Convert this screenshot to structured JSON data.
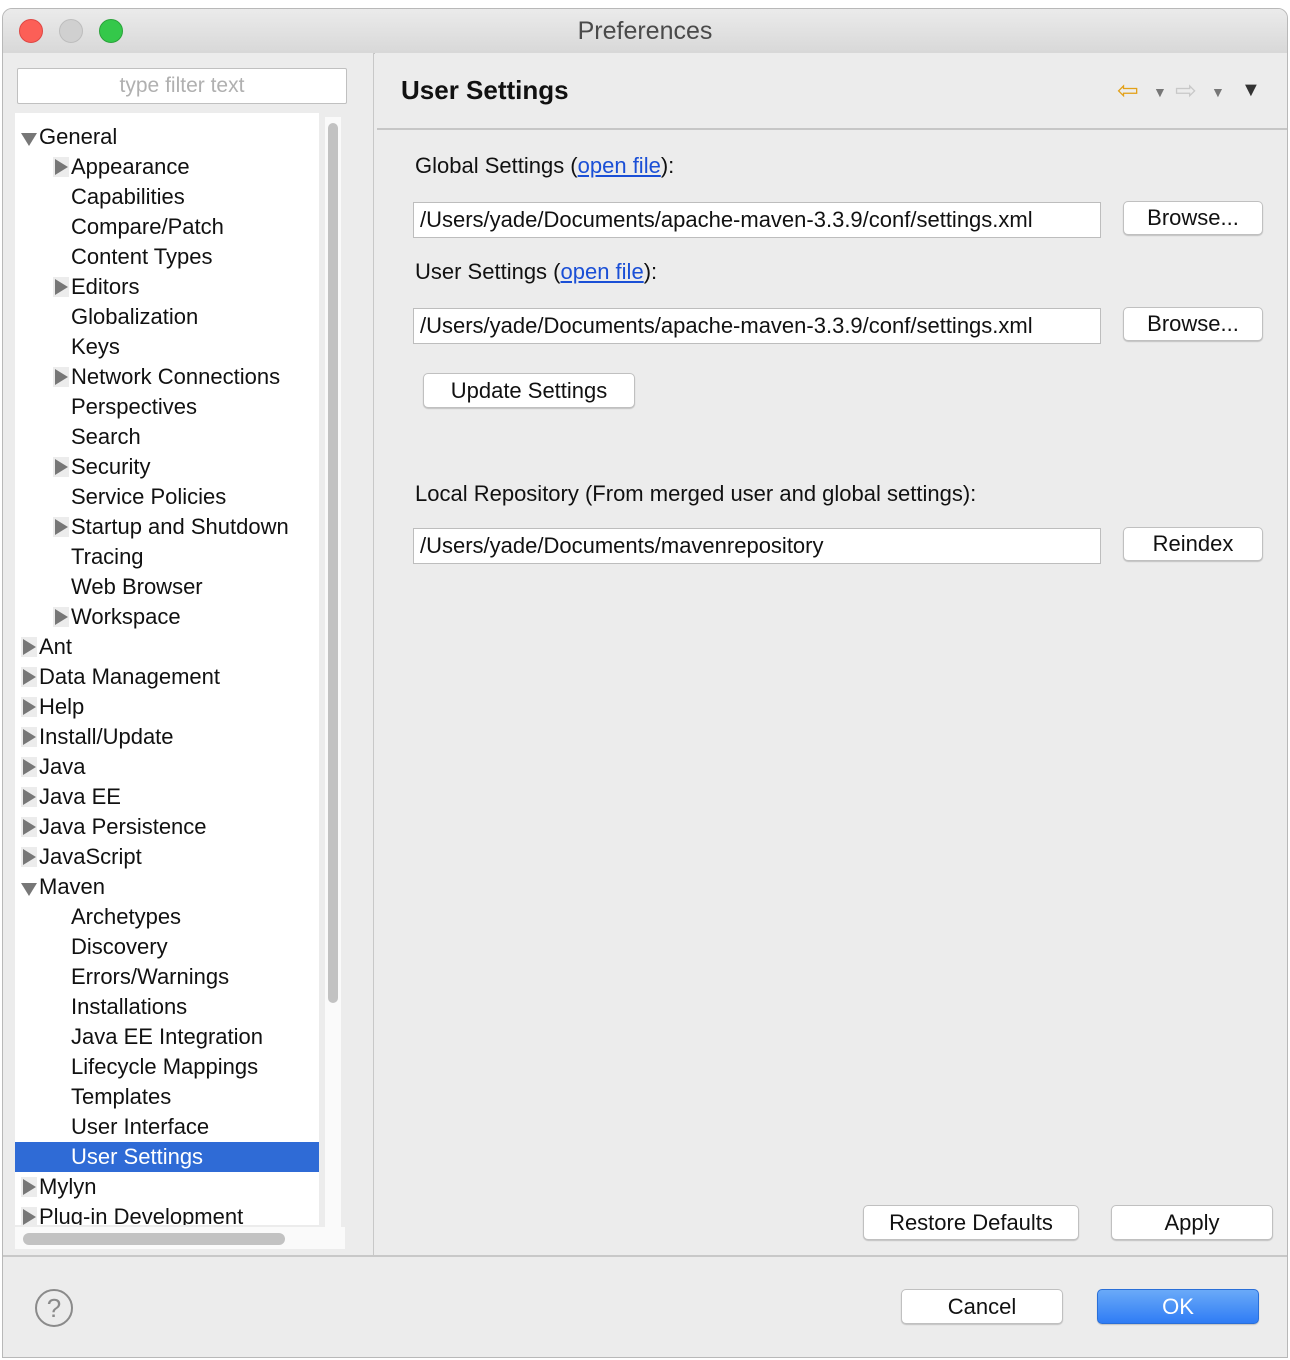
{
  "window": {
    "title": "Preferences"
  },
  "filter": {
    "placeholder": "type filter text"
  },
  "tree": [
    {
      "label": "General",
      "level": 0,
      "toggle": "down"
    },
    {
      "label": "Appearance",
      "level": 1,
      "toggle": "right"
    },
    {
      "label": "Capabilities",
      "level": 1,
      "toggle": "none"
    },
    {
      "label": "Compare/Patch",
      "level": 1,
      "toggle": "none"
    },
    {
      "label": "Content Types",
      "level": 1,
      "toggle": "none"
    },
    {
      "label": "Editors",
      "level": 1,
      "toggle": "right"
    },
    {
      "label": "Globalization",
      "level": 1,
      "toggle": "none"
    },
    {
      "label": "Keys",
      "level": 1,
      "toggle": "none"
    },
    {
      "label": "Network Connections",
      "level": 1,
      "toggle": "right"
    },
    {
      "label": "Perspectives",
      "level": 1,
      "toggle": "none"
    },
    {
      "label": "Search",
      "level": 1,
      "toggle": "none"
    },
    {
      "label": "Security",
      "level": 1,
      "toggle": "right"
    },
    {
      "label": "Service Policies",
      "level": 1,
      "toggle": "none"
    },
    {
      "label": "Startup and Shutdown",
      "level": 1,
      "toggle": "right"
    },
    {
      "label": "Tracing",
      "level": 1,
      "toggle": "none"
    },
    {
      "label": "Web Browser",
      "level": 1,
      "toggle": "none"
    },
    {
      "label": "Workspace",
      "level": 1,
      "toggle": "right"
    },
    {
      "label": "Ant",
      "level": 0,
      "toggle": "right"
    },
    {
      "label": "Data Management",
      "level": 0,
      "toggle": "right"
    },
    {
      "label": "Help",
      "level": 0,
      "toggle": "right"
    },
    {
      "label": "Install/Update",
      "level": 0,
      "toggle": "right"
    },
    {
      "label": "Java",
      "level": 0,
      "toggle": "right"
    },
    {
      "label": "Java EE",
      "level": 0,
      "toggle": "right"
    },
    {
      "label": "Java Persistence",
      "level": 0,
      "toggle": "right"
    },
    {
      "label": "JavaScript",
      "level": 0,
      "toggle": "right"
    },
    {
      "label": "Maven",
      "level": 0,
      "toggle": "down"
    },
    {
      "label": "Archetypes",
      "level": 1,
      "toggle": "none"
    },
    {
      "label": "Discovery",
      "level": 1,
      "toggle": "none"
    },
    {
      "label": "Errors/Warnings",
      "level": 1,
      "toggle": "none"
    },
    {
      "label": "Installations",
      "level": 1,
      "toggle": "none"
    },
    {
      "label": "Java EE Integration",
      "level": 1,
      "toggle": "none"
    },
    {
      "label": "Lifecycle Mappings",
      "level": 1,
      "toggle": "none"
    },
    {
      "label": "Templates",
      "level": 1,
      "toggle": "none"
    },
    {
      "label": "User Interface",
      "level": 1,
      "toggle": "none"
    },
    {
      "label": "User Settings",
      "level": 1,
      "toggle": "none",
      "selected": true
    },
    {
      "label": "Mylyn",
      "level": 0,
      "toggle": "right"
    },
    {
      "label": "Plug-in Development",
      "level": 0,
      "toggle": "right"
    }
  ],
  "page": {
    "title": "User Settings",
    "global_label_prefix": "Global Settings (",
    "global_link": "open file",
    "global_label_suffix": "):",
    "global_path": "/Users/yade/Documents/apache-maven-3.3.9/conf/settings.xml",
    "browse_label": "Browse...",
    "user_label_prefix": "User Settings (",
    "user_link": "open file",
    "user_label_suffix": "):",
    "user_path": "/Users/yade/Documents/apache-maven-3.3.9/conf/settings.xml",
    "update_label": "Update Settings",
    "local_repo_label": "Local Repository (From merged user and global settings):",
    "local_repo_path": "/Users/yade/Documents/mavenrepository",
    "reindex_label": "Reindex",
    "restore_label": "Restore Defaults",
    "apply_label": "Apply"
  },
  "footer": {
    "help_symbol": "?",
    "cancel_label": "Cancel",
    "ok_label": "OK"
  },
  "icons": {
    "back": "back-arrow-icon",
    "forward": "forward-arrow-icon",
    "menu": "view-menu-icon"
  },
  "colors": {
    "selection": "#2f6bd6",
    "link": "#1a4fd6",
    "ok_button": "#2f7cf5"
  }
}
